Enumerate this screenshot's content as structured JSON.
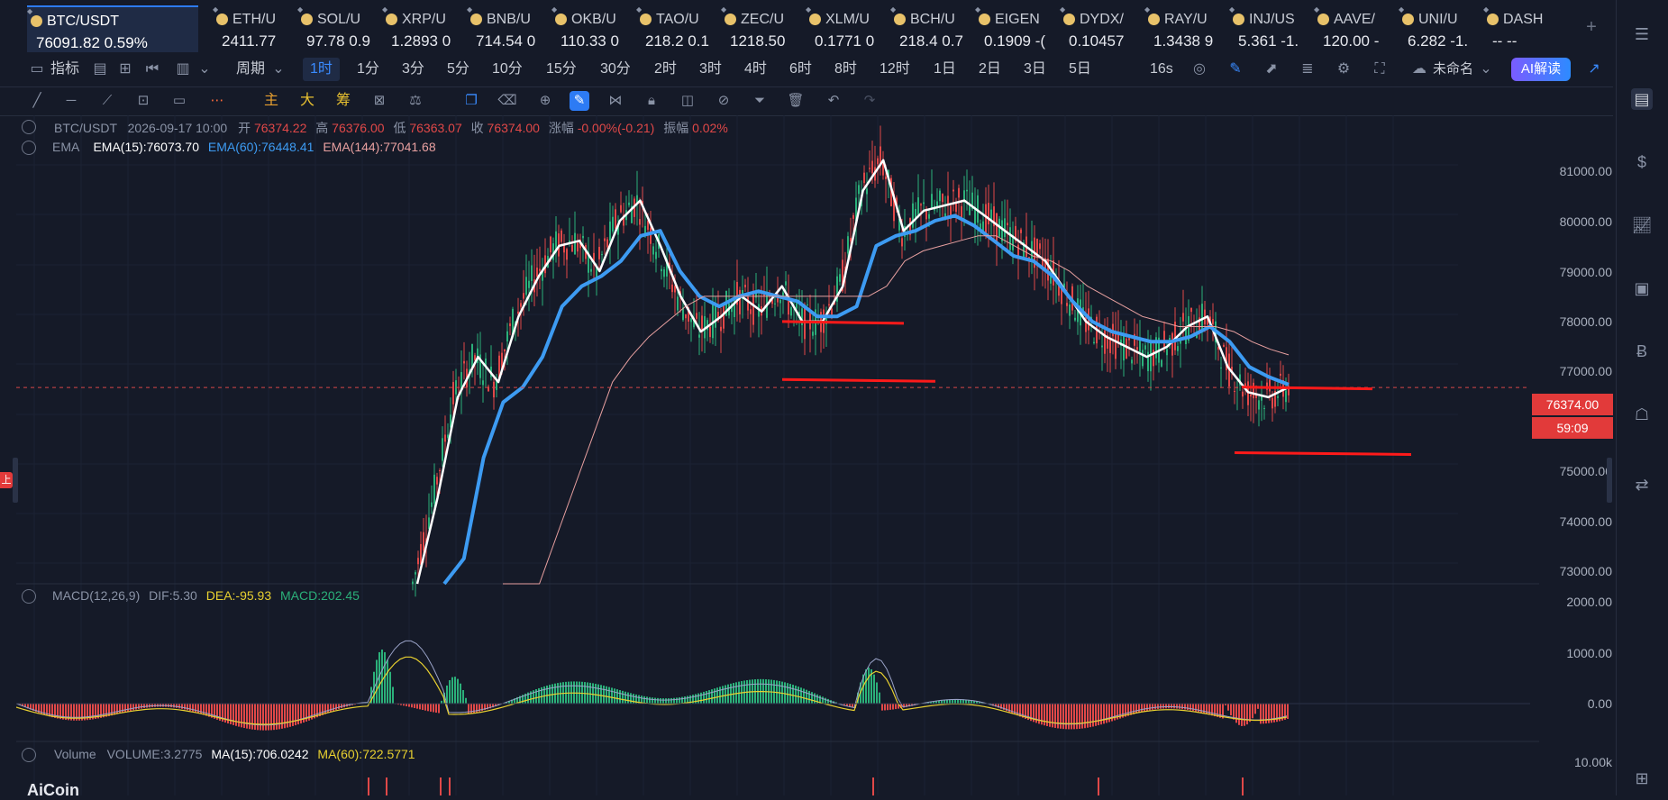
{
  "tickers": [
    {
      "sym": "BTC/USDT",
      "price": "76091.82",
      "chg": "0.59%",
      "active": true
    },
    {
      "sym": "ETH/U",
      "price": "2411.77",
      "chg": ""
    },
    {
      "sym": "SOL/U",
      "price": "97.78",
      "chg": "0.9"
    },
    {
      "sym": "XRP/U",
      "price": "1.2893",
      "chg": "0"
    },
    {
      "sym": "BNB/U",
      "price": "714.54",
      "chg": "0"
    },
    {
      "sym": "OKB/U",
      "price": "110.33",
      "chg": "0"
    },
    {
      "sym": "TAO/U",
      "price": "218.2",
      "chg": "0.1"
    },
    {
      "sym": "ZEC/U",
      "price": "1218.50",
      "chg": ""
    },
    {
      "sym": "XLM/U",
      "price": "0.1771",
      "chg": "0"
    },
    {
      "sym": "BCH/U",
      "price": "218.4",
      "chg": "0.7"
    },
    {
      "sym": "EIGEN",
      "price": "0.1909",
      "chg": "-("
    },
    {
      "sym": "DYDX/",
      "price": "0.10457",
      "chg": ""
    },
    {
      "sym": "RAY/U",
      "price": "1.3438",
      "chg": "9"
    },
    {
      "sym": "INJ/US",
      "price": "5.361",
      "chg": "-1."
    },
    {
      "sym": "AAVE/",
      "price": "120.00",
      "chg": "-"
    },
    {
      "sym": "UNI/U",
      "price": "6.282",
      "chg": "-1."
    },
    {
      "sym": "DASH",
      "price": "-- --",
      "chg": ""
    }
  ],
  "toolbar": {
    "indicators_label": "指标",
    "period_label": "周期",
    "intervals": [
      "1时",
      "1分",
      "3分",
      "5分",
      "10分",
      "15分",
      "30分",
      "2时",
      "3时",
      "4时",
      "6时",
      "8时",
      "12时",
      "1日",
      "2日",
      "3日",
      "5日"
    ],
    "selected_interval": "1时",
    "countdown": "16s",
    "layout_name": "未命名",
    "ai_label": "AI解读"
  },
  "drawing_tools": {
    "main": "主",
    "big": "大",
    "chip": "筹"
  },
  "ohlc_legend": {
    "pair": "BTC/USDT",
    "datetime": "2026-09-17 10:00",
    "open_label": "开",
    "open": "76374.22",
    "high_label": "高",
    "high": "76376.00",
    "low_label": "低",
    "low": "76363.07",
    "close_label": "收",
    "close": "76374.00",
    "change_label": "涨幅",
    "change": "-0.00%(-0.21)",
    "amp_label": "振幅",
    "amp": "0.02%"
  },
  "ema_legend": {
    "name": "EMA",
    "ema15": "EMA(15):76073.70",
    "ema60": "EMA(60):76448.41",
    "ema144": "EMA(144):77041.68"
  },
  "macd_legend": {
    "name": "MACD(12,26,9)",
    "dif": "DIF:5.30",
    "dea": "DEA:-95.93",
    "macd": "MACD:202.45"
  },
  "volume_legend": {
    "name": "Volume",
    "vol": "VOLUME:3.2775",
    "ma15": "MA(15):706.0242",
    "ma60": "MA(60):722.5771"
  },
  "price_axis": [
    "81000.00",
    "80000.00",
    "79000.00",
    "78000.00",
    "77000.00",
    "75000.00",
    "74000.00",
    "73000.00"
  ],
  "current_price": "76374.00",
  "candle_timer": "59:09",
  "macd_axis": [
    "2000.00",
    "1000.00",
    "0.00"
  ],
  "volume_axis": [
    "10.00k"
  ],
  "left_tag": "上",
  "brand": "AiCoin",
  "colors": {
    "up": "#2bb07a",
    "down": "#e04848",
    "ema15": "#ffffff",
    "ema60": "#3d9bf2",
    "ema144": "#e8a0a0",
    "bg": "#151a28",
    "hline": "#ff1a1a"
  },
  "chart_data": {
    "type": "line",
    "series": [
      {
        "name": "EMA(15)",
        "y": [
          72500,
          74200,
          76200,
          77000,
          76500,
          77800,
          78600,
          79200,
          79300,
          78700,
          79700,
          80100,
          79200,
          78200,
          77500,
          77800,
          78200,
          77900,
          78400,
          77700,
          77700,
          78400,
          80300,
          80900,
          79500,
          79900,
          80000,
          80100,
          79800,
          79500,
          79200,
          78900,
          78300,
          77700,
          77400,
          77200,
          77000,
          77200,
          77600,
          77800,
          76800,
          76300,
          76200,
          76400
        ]
      },
      {
        "name": "EMA(60)",
        "y": [
          71000,
          73000,
          75000,
          76100,
          76400,
          77000,
          78000,
          78400,
          78600,
          78900,
          79400,
          79500,
          78700,
          78200,
          78000,
          78200,
          78300,
          78200,
          78100,
          77800,
          77800,
          78000,
          79200,
          79400,
          79500,
          79700,
          79800,
          79600,
          79300,
          79000,
          78900,
          78600,
          78100,
          77700,
          77500,
          77400,
          77300,
          77300,
          77400,
          77600,
          77300,
          76800,
          76600,
          76450
        ]
      },
      {
        "name": "EMA(144)",
        "y": [
          70000,
          70800,
          72000,
          73500,
          74500,
          75500,
          76500,
          77000,
          77400,
          77700,
          78000,
          78200,
          78200,
          78200,
          78200,
          78200,
          78200,
          78200,
          78200,
          78200,
          78200,
          78400,
          78900,
          79100,
          79200,
          79300,
          79400,
          79400,
          79200,
          79000,
          78900,
          78700,
          78400,
          78200,
          78000,
          77800,
          77700,
          77600,
          77600,
          77600,
          77500,
          77300,
          77150,
          77040
        ]
      }
    ],
    "ylim": [
      72500,
      81700
    ],
    "hlines": [
      77700,
      76550,
      76400,
      75100
    ]
  }
}
